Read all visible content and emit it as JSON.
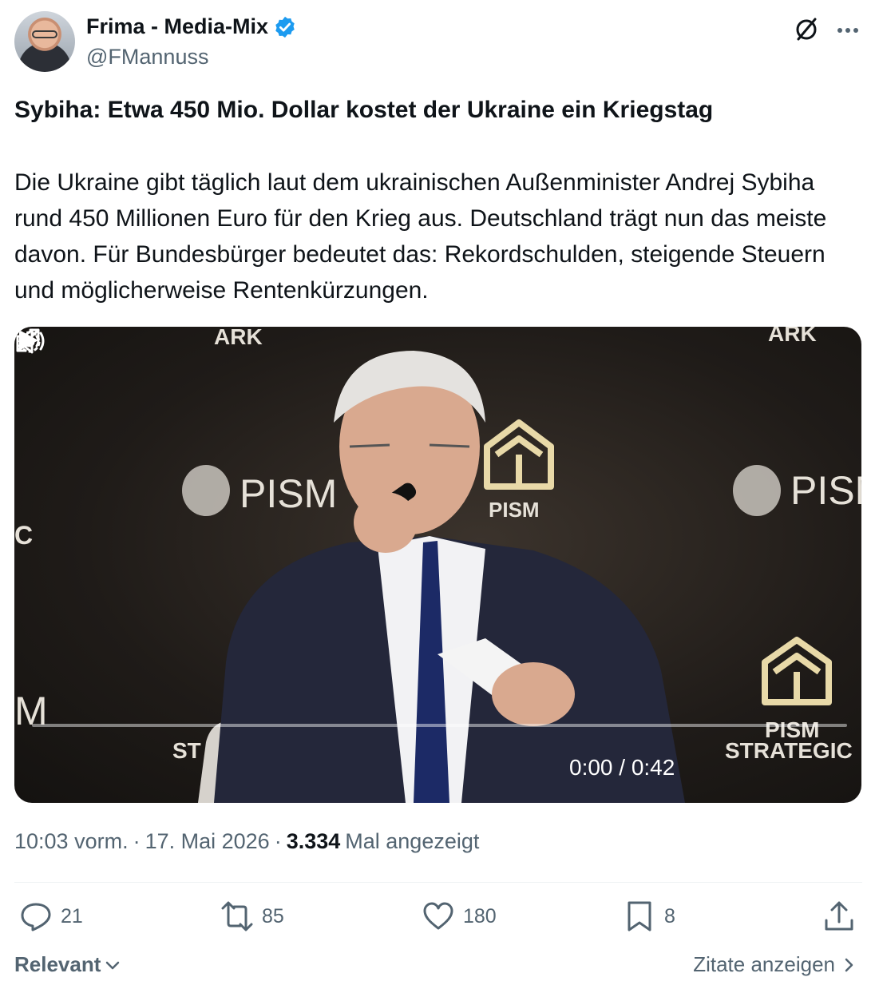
{
  "author": {
    "name": "Frima - Media-Mix",
    "handle": "@FMannuss"
  },
  "post": {
    "title": "Sybiha: Etwa 450 Mio. Dollar kostet der Ukraine ein Kriegstag",
    "body": "Die Ukraine gibt täglich laut dem ukrainischen Außenminister Andrej Sybiha rund 450 Millionen Euro für den Krieg aus. Deutschland trägt nun das meiste davon. Für Bundesbürger bedeutet das: Rekordschulden, steigende Steuern und möglicherweise Rentenkürzungen."
  },
  "video": {
    "time": "0:00 / 0:42",
    "progress": 0,
    "backdrop_text": {
      "ark_left": "ARK",
      "ark_right": "ARK",
      "pism_left": "PISM",
      "pism_right": "PISM",
      "pism_center": "PISM",
      "pism_bottom": "PISM",
      "strategic": "STRATEGIC",
      "edge_c": "C",
      "edge_m": "M",
      "st_left": "ST"
    }
  },
  "meta": {
    "time": "10:03 vorm.",
    "sep1": "·",
    "date": "17. Mai 2026",
    "sep2": "·",
    "views": "3.334",
    "views_label": "Mal angezeigt"
  },
  "actions": {
    "replies": "21",
    "reposts": "85",
    "likes": "180",
    "bookmarks": "8"
  },
  "footer": {
    "sort": "Relevant",
    "quotes": "Zitate anzeigen"
  },
  "colors": {
    "text": "#0f1419",
    "secondary": "#536471",
    "verified": "#1d9bf0",
    "divider": "#eff3f4"
  },
  "icons": [
    "verified-badge-icon",
    "grok-icon",
    "more-icon",
    "play-icon",
    "volume-icon",
    "settings-icon",
    "fullscreen-icon",
    "reply-icon",
    "repost-icon",
    "like-icon",
    "bookmark-icon",
    "share-icon",
    "chevron-down-icon",
    "chevron-right-icon"
  ]
}
